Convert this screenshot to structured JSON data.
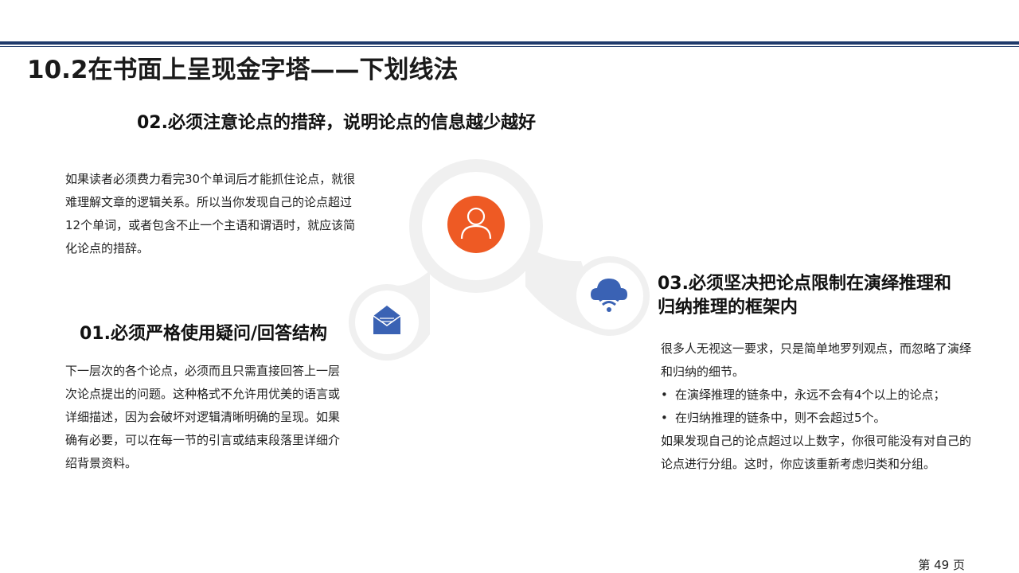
{
  "title": "10.2在书面上呈现金字塔——下划线法",
  "section02": {
    "heading": "02.必须注意论点的措辞，说明论点的信息越少越好",
    "body": "如果读者必须费力看完30个单词后才能抓住论点，就很难理解文章的逻辑关系。所以当你发现自己的论点超过12个单词，或者包含不止一个主语和谓语时，就应该简化论点的措辞。"
  },
  "section01": {
    "heading": "01.必须严格使用疑问/回答结构",
    "body": "下一层次的各个论点，必须而且只需直接回答上一层次论点提出的问题。这种格式不允许用优美的语言或详细描述，因为会破坏对逻辑清晰明确的呈现。如果确有必要，可以在每一节的引言或结束段落里详细介绍背景资料。"
  },
  "section03": {
    "heading": "03.必须坚决把论点限制在演绎推理和归纳推理的框架内",
    "intro": "很多人无视这一要求，只是简单地罗列观点，而忽略了演绎和归纳的细节。",
    "bullets": [
      "在演绎推理的链条中，永远不会有4个以上的论点；",
      "在归纳推理的链条中，则不会超过5个。"
    ],
    "outro": "如果发现自己的论点超过以上数字，你很可能没有对自己的论点进行分组。这时，你应该重新考虑归类和分组。"
  },
  "bullet_symbol": "•",
  "footer": {
    "page": "第 49 页"
  },
  "icons": {
    "person": "person-icon",
    "mail": "mail-icon",
    "wifi_cloud": "wifi-cloud-icon"
  },
  "colors": {
    "accent_orange": "#ee5a24",
    "accent_blue": "#3a62b4",
    "rule_navy": "#1f3a6b",
    "connector_gray": "#f0f0f0"
  }
}
